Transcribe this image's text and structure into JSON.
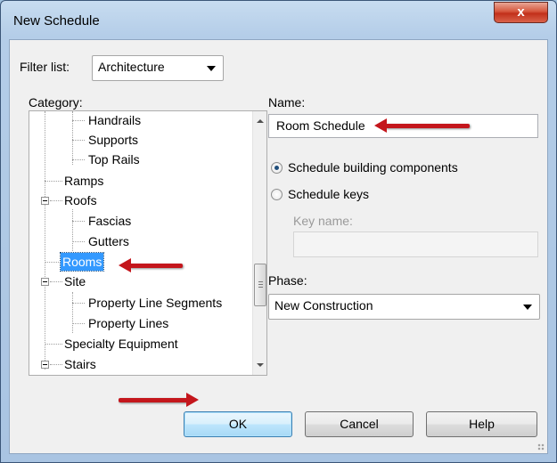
{
  "window": {
    "title": "New Schedule",
    "close_label": "x"
  },
  "filter": {
    "label": "Filter list:",
    "value": "Architecture"
  },
  "category": {
    "label": "Category:",
    "items": [
      {
        "label": "Handrails",
        "level": 2
      },
      {
        "label": "Supports",
        "level": 2
      },
      {
        "label": "Top Rails",
        "level": 2
      },
      {
        "label": "Ramps",
        "level": 1
      },
      {
        "label": "Roofs",
        "level": 1,
        "expanded": true
      },
      {
        "label": "Fascias",
        "level": 2
      },
      {
        "label": "Gutters",
        "level": 2
      },
      {
        "label": "Rooms",
        "level": 1,
        "selected": true
      },
      {
        "label": "Site",
        "level": 1,
        "expanded": true
      },
      {
        "label": "Property Line Segments",
        "level": 2
      },
      {
        "label": "Property Lines",
        "level": 2
      },
      {
        "label": "Specialty Equipment",
        "level": 1
      },
      {
        "label": "Stairs",
        "level": 1,
        "expanded": true
      }
    ]
  },
  "name": {
    "label": "Name:",
    "value": "Room Schedule"
  },
  "schedule_type": {
    "options": [
      {
        "label": "Schedule building components",
        "selected": true
      },
      {
        "label": "Schedule keys",
        "selected": false
      }
    ]
  },
  "key_name": {
    "label": "Key name:",
    "value": ""
  },
  "phase": {
    "label": "Phase:",
    "value": "New Construction"
  },
  "buttons": {
    "ok": "OK",
    "cancel": "Cancel",
    "help": "Help"
  },
  "colors": {
    "selection": "#3399ff",
    "annotation_arrow": "#c4161c",
    "close_button": "#c2301a"
  },
  "icons": [
    "close-icon",
    "chevron-down-icon",
    "collapse-icon",
    "annotation-arrow-icon"
  ]
}
